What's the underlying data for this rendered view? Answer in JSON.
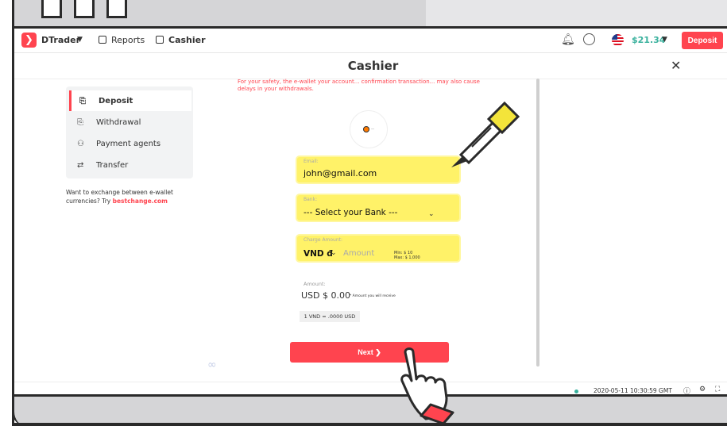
{
  "header": {
    "brand": "DTrader",
    "reports": "Reports",
    "cashier": "Cashier",
    "balance": "$21.34",
    "deposit_label": "Deposit"
  },
  "page": {
    "title": "Cashier"
  },
  "sidebar": {
    "items": [
      {
        "label": "Deposit"
      },
      {
        "label": "Withdrawal"
      },
      {
        "label": "Payment agents"
      },
      {
        "label": "Transfer"
      }
    ],
    "exchange_text": "Want to exchange between e-wallet currencies? Try ",
    "exchange_link": "bestchange.com"
  },
  "form": {
    "warning_line1": "For your safety, the e-wallet your account... confirmation transaction... may also cause",
    "warning_line2": "delays in your withdrawals.",
    "email_label": "Email:",
    "email_value": "john@gmail.com",
    "bank_label": "Bank:",
    "bank_value": "--- Select your Bank ---",
    "charge_label": "Charge Amount:",
    "currency": "VND đ",
    "amount_placeholder": "Amount",
    "min": "Min:   $ 10",
    "max": "Max: $ 1,000",
    "amount_label": "Amount:",
    "amount_value": "USD $ 0.00",
    "amount_note": "* Amount you will receive",
    "rate": "1 VND = .0000 USD",
    "next_label": "Next ❯"
  },
  "footer": {
    "datetime": "2020-05-11 10:30:59 GMT"
  },
  "colors": {
    "accent": "#ff444f",
    "balance": "#39b19d",
    "highlight": "#fff268"
  }
}
